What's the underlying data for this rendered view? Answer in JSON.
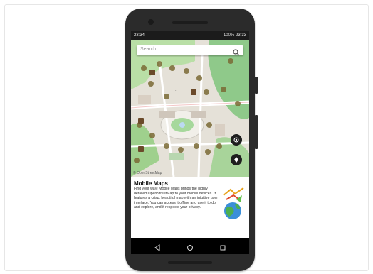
{
  "status_bar": {
    "left": "23:34",
    "right": "100% 23:33"
  },
  "search": {
    "placeholder": "Search"
  },
  "map": {
    "label": "Mobile Maps",
    "attribution": "© OpenStreetMap"
  },
  "info": {
    "title": "Mobile Maps",
    "description": "Find your way! Mobile Maps brings the highly detailed OpenStreetMap to your mobile devices. It features a crisp, beautiful map with an intuitive user interface. You can access it offline and use it to do and explore, and it respects your privacy."
  },
  "nav": {
    "back": "◁",
    "home": "○",
    "recents": "□"
  },
  "colors": {
    "accent": "#2d6cdf",
    "park": "#a6d89c",
    "forest": "#8dc48a"
  }
}
